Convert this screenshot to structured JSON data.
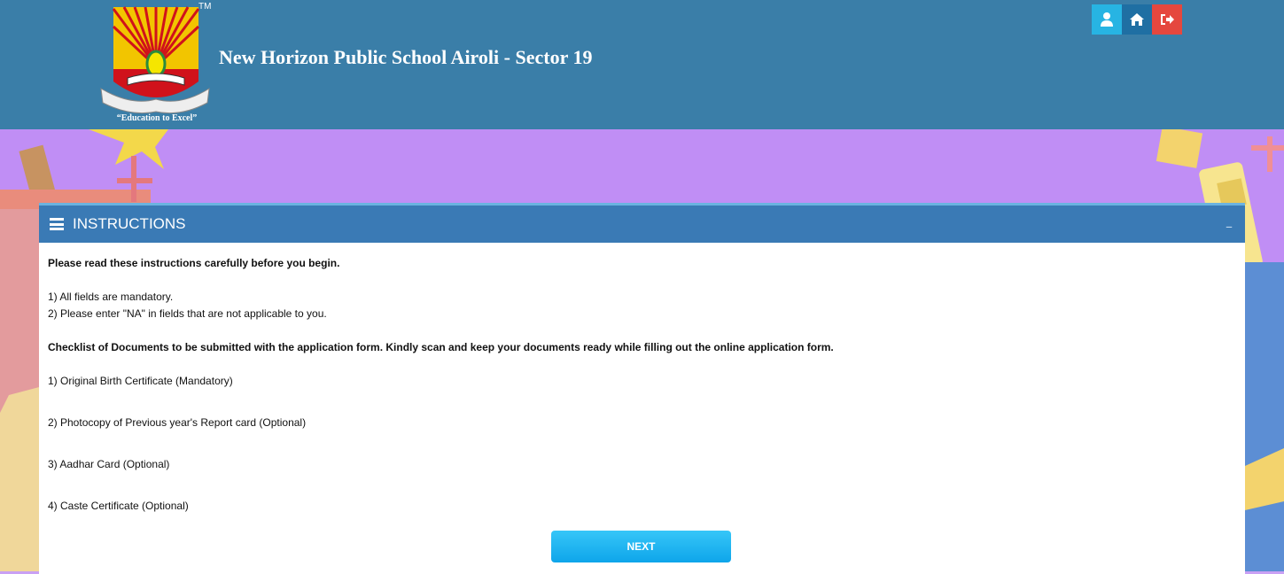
{
  "header": {
    "tm": "TM",
    "motto": "“Education to Excel”",
    "school_name": "New Horizon Public School Airoli - Sector 19",
    "icons": [
      "user-icon",
      "home-icon",
      "logout-icon"
    ]
  },
  "panel": {
    "title": "INSTRUCTIONS",
    "collapse_symbol": "–",
    "intro": "Please read these instructions carefully before you begin.",
    "rules": [
      "1) All fields are mandatory.",
      "2) Please enter \"NA\" in fields that are not applicable to you."
    ],
    "checklist_heading": "Checklist of Documents to be submitted with the application form. Kindly scan and keep your documents ready while filling out the online application form.",
    "documents": [
      "1) Original Birth Certificate (Mandatory)",
      "2) Photocopy of Previous year's Report card (Optional)",
      "3) Aadhar Card (Optional)",
      "4) Caste Certificate (Optional)"
    ],
    "next_label": "NEXT"
  },
  "colors": {
    "header_bg": "#3a7ea8",
    "panel_header_bg": "#3a7ab5",
    "background_purple": "#c08ef5",
    "next_button": "#18aef0"
  }
}
